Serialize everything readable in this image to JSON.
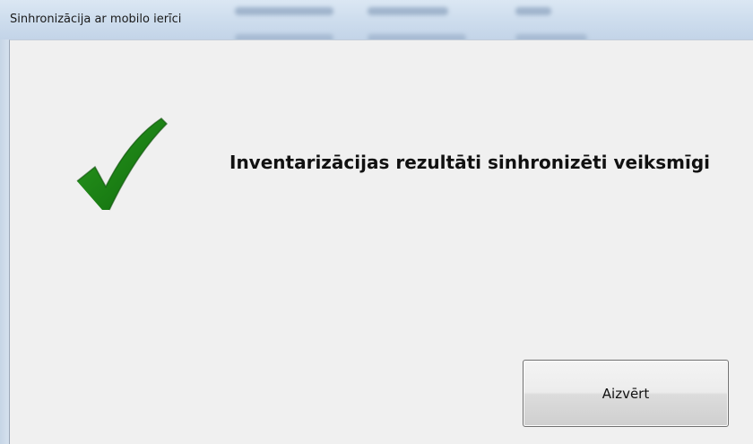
{
  "window": {
    "title": "Sinhronizācija ar mobilo ierīci"
  },
  "dialog": {
    "status_icon": "checkmark-icon",
    "message": "Inventarizācijas rezultāti sinhronizēti veiksmīgi",
    "close_button_label": "Aizvērt"
  },
  "colors": {
    "check_green": "#1e8a16",
    "check_dark": "#0f5e0b",
    "dialog_background": "#f0f0f0"
  }
}
